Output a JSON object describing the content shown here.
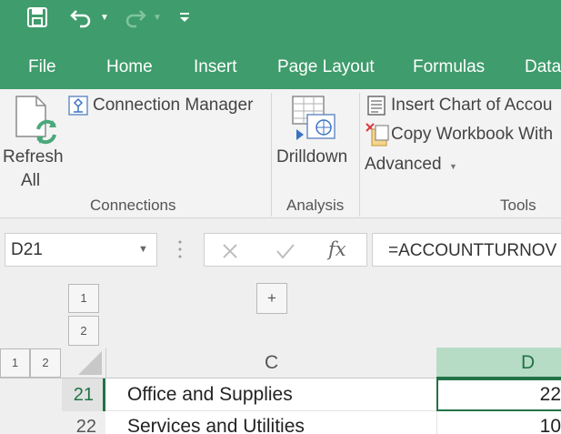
{
  "quick_access": {
    "save_icon": "save-icon",
    "undo_icon": "undo-icon",
    "redo_icon": "redo-icon",
    "customize_icon": "customize-qat-icon"
  },
  "tabs": [
    "File",
    "Home",
    "Insert",
    "Page Layout",
    "Formulas",
    "Data"
  ],
  "ribbon": {
    "refresh_all": {
      "line1": "Refresh",
      "line2": "All"
    },
    "connection_manager": "Connection Manager",
    "connections_group": "Connections",
    "drilldown": "Drilldown",
    "analysis_group": "Analysis",
    "insert_chart": "Insert Chart of Accou",
    "copy_workbook": "Copy Workbook With",
    "advanced": "Advanced",
    "tools_group": "Tools"
  },
  "formula_bar": {
    "name_box": "D21",
    "fx": "fx",
    "formula": "=ACCOUNTTURNOV"
  },
  "outline": {
    "row_levels": [
      "1",
      "2"
    ],
    "col_levels": [
      "1",
      "2"
    ],
    "expand": "+"
  },
  "grid": {
    "columns": [
      "C",
      "D"
    ],
    "rows": [
      {
        "num": "21",
        "c": "Office and Supplies",
        "d": "22"
      },
      {
        "num": "22",
        "c": "Services and Utilities",
        "d": "10"
      }
    ]
  },
  "colors": {
    "accent": "#3f9c6c",
    "selected_header": "#b7dcc5",
    "selected_border": "#217346"
  }
}
